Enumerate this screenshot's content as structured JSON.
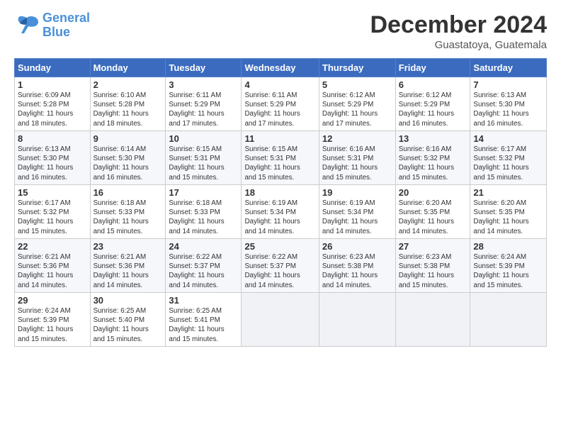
{
  "header": {
    "logo_line1": "General",
    "logo_line2": "Blue",
    "month": "December 2024",
    "location": "Guastatoya, Guatemala"
  },
  "weekdays": [
    "Sunday",
    "Monday",
    "Tuesday",
    "Wednesday",
    "Thursday",
    "Friday",
    "Saturday"
  ],
  "weeks": [
    [
      {
        "day": "1",
        "info": "Sunrise: 6:09 AM\nSunset: 5:28 PM\nDaylight: 11 hours\nand 18 minutes."
      },
      {
        "day": "2",
        "info": "Sunrise: 6:10 AM\nSunset: 5:28 PM\nDaylight: 11 hours\nand 18 minutes."
      },
      {
        "day": "3",
        "info": "Sunrise: 6:11 AM\nSunset: 5:29 PM\nDaylight: 11 hours\nand 17 minutes."
      },
      {
        "day": "4",
        "info": "Sunrise: 6:11 AM\nSunset: 5:29 PM\nDaylight: 11 hours\nand 17 minutes."
      },
      {
        "day": "5",
        "info": "Sunrise: 6:12 AM\nSunset: 5:29 PM\nDaylight: 11 hours\nand 17 minutes."
      },
      {
        "day": "6",
        "info": "Sunrise: 6:12 AM\nSunset: 5:29 PM\nDaylight: 11 hours\nand 16 minutes."
      },
      {
        "day": "7",
        "info": "Sunrise: 6:13 AM\nSunset: 5:30 PM\nDaylight: 11 hours\nand 16 minutes."
      }
    ],
    [
      {
        "day": "8",
        "info": "Sunrise: 6:13 AM\nSunset: 5:30 PM\nDaylight: 11 hours\nand 16 minutes."
      },
      {
        "day": "9",
        "info": "Sunrise: 6:14 AM\nSunset: 5:30 PM\nDaylight: 11 hours\nand 16 minutes."
      },
      {
        "day": "10",
        "info": "Sunrise: 6:15 AM\nSunset: 5:31 PM\nDaylight: 11 hours\nand 15 minutes."
      },
      {
        "day": "11",
        "info": "Sunrise: 6:15 AM\nSunset: 5:31 PM\nDaylight: 11 hours\nand 15 minutes."
      },
      {
        "day": "12",
        "info": "Sunrise: 6:16 AM\nSunset: 5:31 PM\nDaylight: 11 hours\nand 15 minutes."
      },
      {
        "day": "13",
        "info": "Sunrise: 6:16 AM\nSunset: 5:32 PM\nDaylight: 11 hours\nand 15 minutes."
      },
      {
        "day": "14",
        "info": "Sunrise: 6:17 AM\nSunset: 5:32 PM\nDaylight: 11 hours\nand 15 minutes."
      }
    ],
    [
      {
        "day": "15",
        "info": "Sunrise: 6:17 AM\nSunset: 5:32 PM\nDaylight: 11 hours\nand 15 minutes."
      },
      {
        "day": "16",
        "info": "Sunrise: 6:18 AM\nSunset: 5:33 PM\nDaylight: 11 hours\nand 15 minutes."
      },
      {
        "day": "17",
        "info": "Sunrise: 6:18 AM\nSunset: 5:33 PM\nDaylight: 11 hours\nand 14 minutes."
      },
      {
        "day": "18",
        "info": "Sunrise: 6:19 AM\nSunset: 5:34 PM\nDaylight: 11 hours\nand 14 minutes."
      },
      {
        "day": "19",
        "info": "Sunrise: 6:19 AM\nSunset: 5:34 PM\nDaylight: 11 hours\nand 14 minutes."
      },
      {
        "day": "20",
        "info": "Sunrise: 6:20 AM\nSunset: 5:35 PM\nDaylight: 11 hours\nand 14 minutes."
      },
      {
        "day": "21",
        "info": "Sunrise: 6:20 AM\nSunset: 5:35 PM\nDaylight: 11 hours\nand 14 minutes."
      }
    ],
    [
      {
        "day": "22",
        "info": "Sunrise: 6:21 AM\nSunset: 5:36 PM\nDaylight: 11 hours\nand 14 minutes."
      },
      {
        "day": "23",
        "info": "Sunrise: 6:21 AM\nSunset: 5:36 PM\nDaylight: 11 hours\nand 14 minutes."
      },
      {
        "day": "24",
        "info": "Sunrise: 6:22 AM\nSunset: 5:37 PM\nDaylight: 11 hours\nand 14 minutes."
      },
      {
        "day": "25",
        "info": "Sunrise: 6:22 AM\nSunset: 5:37 PM\nDaylight: 11 hours\nand 14 minutes."
      },
      {
        "day": "26",
        "info": "Sunrise: 6:23 AM\nSunset: 5:38 PM\nDaylight: 11 hours\nand 14 minutes."
      },
      {
        "day": "27",
        "info": "Sunrise: 6:23 AM\nSunset: 5:38 PM\nDaylight: 11 hours\nand 15 minutes."
      },
      {
        "day": "28",
        "info": "Sunrise: 6:24 AM\nSunset: 5:39 PM\nDaylight: 11 hours\nand 15 minutes."
      }
    ],
    [
      {
        "day": "29",
        "info": "Sunrise: 6:24 AM\nSunset: 5:39 PM\nDaylight: 11 hours\nand 15 minutes."
      },
      {
        "day": "30",
        "info": "Sunrise: 6:25 AM\nSunset: 5:40 PM\nDaylight: 11 hours\nand 15 minutes."
      },
      {
        "day": "31",
        "info": "Sunrise: 6:25 AM\nSunset: 5:41 PM\nDaylight: 11 hours\nand 15 minutes."
      },
      null,
      null,
      null,
      null
    ]
  ]
}
